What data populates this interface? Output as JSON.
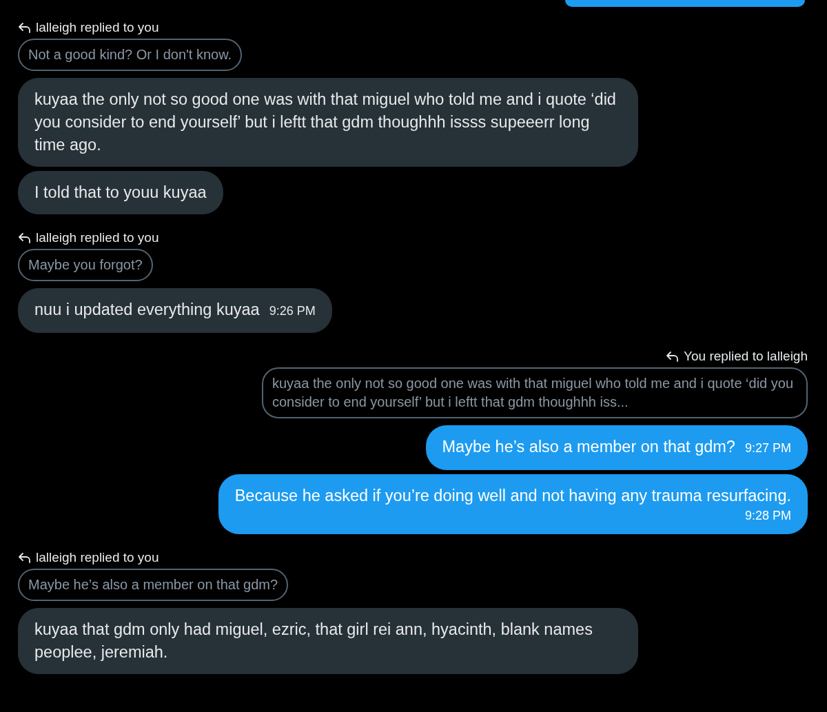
{
  "messages": [
    {
      "kind": "cut_bubble",
      "outgoing": true
    },
    {
      "kind": "message",
      "outgoing": false,
      "reply": {
        "label": "lalleigh replied to you",
        "quote": "Not a good kind? Or I don't know."
      },
      "text": "kuyaa the only not so good one was with that miguel who told me and i quote ‘did you consider to end yourself’ but i leftt that gdm thoughhh issss supeeerr long time ago."
    },
    {
      "kind": "message",
      "outgoing": false,
      "text": "I told that to youu kuyaa"
    },
    {
      "kind": "message",
      "outgoing": false,
      "reply": {
        "label": "lalleigh replied to you",
        "quote": "Maybe you forgot?"
      },
      "text": "nuu i updated everything kuyaa",
      "time": "9:26 PM"
    },
    {
      "kind": "message",
      "outgoing": true,
      "reply": {
        "label": "You replied to lalleigh",
        "quote": "kuyaa the only not so good one was with that miguel who told me and i quote ‘did you consider to end yourself’ but i leftt that gdm thoughhh iss..."
      },
      "text": "Maybe he’s also a member on that gdm?",
      "time": "9:27 PM"
    },
    {
      "kind": "message",
      "outgoing": true,
      "text": "Because he asked if you’re doing well and not having any trauma resurfacing.",
      "time": "9:28 PM",
      "time_below": true
    },
    {
      "kind": "message",
      "outgoing": false,
      "reply": {
        "label": "lalleigh replied to you",
        "quote": "Maybe he’s also a member on that gdm?"
      },
      "text": "kuyaa that gdm only had miguel, ezric, that girl rei ann, hyacinth, blank names peoplee, jeremiah."
    }
  ]
}
